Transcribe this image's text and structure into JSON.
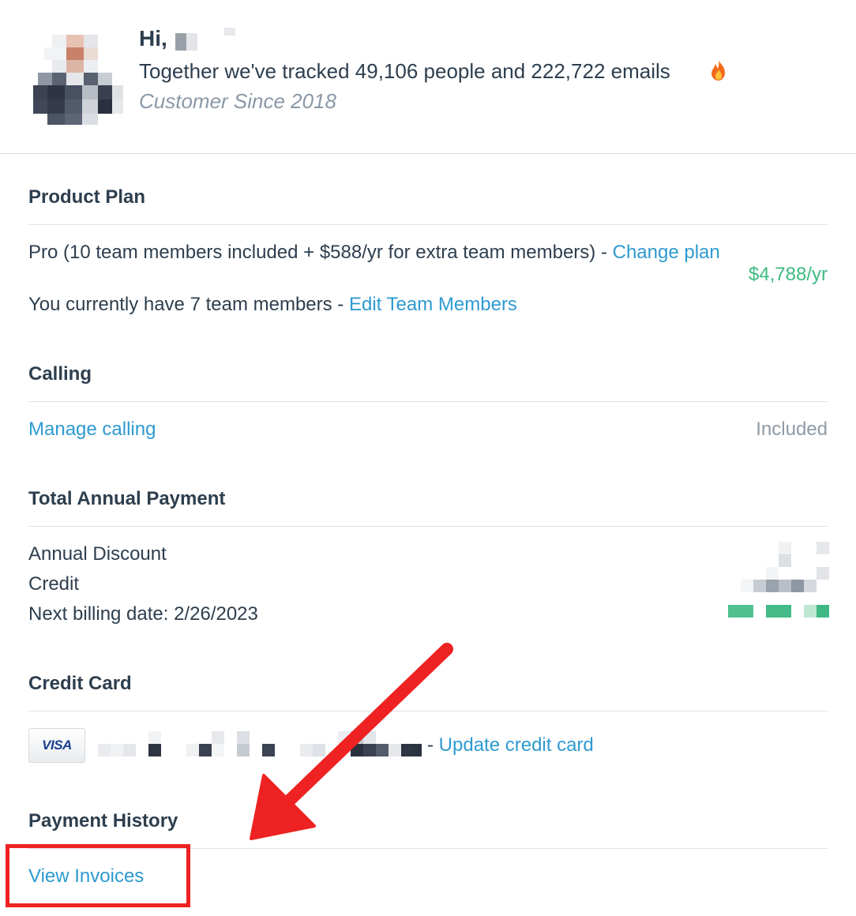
{
  "header": {
    "greeting": "Hi,",
    "tracked_text": "Together we've tracked 49,106 people and 222,722 emails",
    "flame_icon": "flame-icon",
    "customer_since": "Customer Since 2018"
  },
  "product_plan": {
    "title": "Product Plan",
    "plan_text": "Pro (10 team members included + $588/yr for extra team members) - ",
    "change_plan_link": "Change plan",
    "price": "$4,788/yr",
    "team_text": "You currently have 7 team members - ",
    "edit_team_link": "Edit Team Members"
  },
  "calling": {
    "title": "Calling",
    "manage_link": "Manage calling",
    "status": "Included"
  },
  "total_annual_payment": {
    "title": "Total Annual Payment",
    "annual_discount_label": "Annual Discount",
    "credit_label": "Credit",
    "next_billing_label": "Next billing date: 2/26/2023"
  },
  "credit_card": {
    "title": "Credit Card",
    "brand": "VISA",
    "separator": "- ",
    "update_link": "Update credit card"
  },
  "payment_history": {
    "title": "Payment History",
    "view_invoices_link": "View Invoices"
  },
  "colors": {
    "link": "#2e9ad0",
    "price_green": "#3dbb80",
    "annotation_red": "#ee2222",
    "text": "#2d3e4e",
    "muted": "#8e9aa6"
  }
}
